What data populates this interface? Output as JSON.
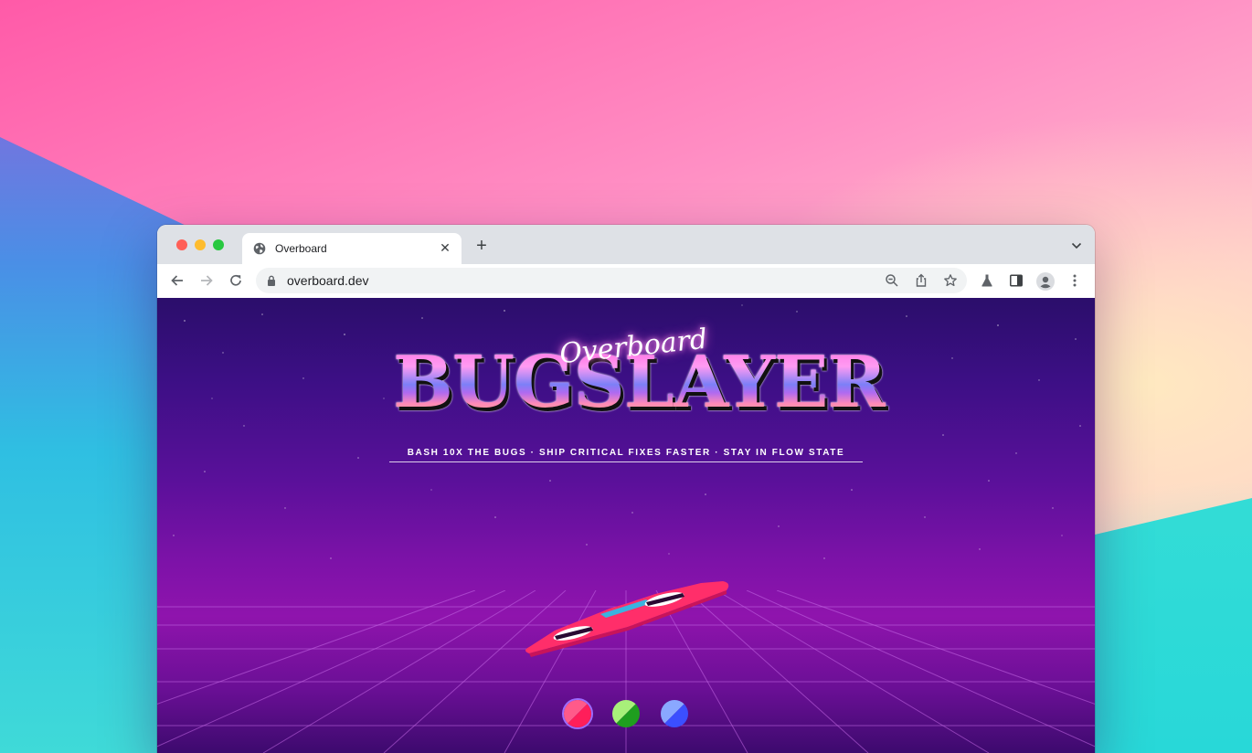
{
  "browser": {
    "tab": {
      "title": "Overboard",
      "icon": "globe-icon"
    },
    "new_tab_label": "+",
    "address_bar": {
      "url": "overboard.dev",
      "icon": "lock-icon"
    }
  },
  "page": {
    "logo": {
      "script_text": "Overboard",
      "main_text": "BUGSLAYER"
    },
    "tagline": "BASH 10X THE BUGS · SHIP CRITICAL FIXES FASTER · STAY IN FLOW STATE",
    "color_swatches": [
      {
        "name": "pink",
        "colors": [
          "#ff5a8a",
          "#ff1e5a"
        ],
        "selected": true
      },
      {
        "name": "green",
        "colors": [
          "#a8f07a",
          "#1f9e1f"
        ],
        "selected": false
      },
      {
        "name": "blue",
        "colors": [
          "#8aa8ff",
          "#3b4fff"
        ],
        "selected": false
      }
    ]
  },
  "colors": {
    "sky_top": "#2b0e6b",
    "sky_mid": "#8f14ad",
    "board_body": "#ff2e6a",
    "grid_line": "#c46ae6"
  }
}
